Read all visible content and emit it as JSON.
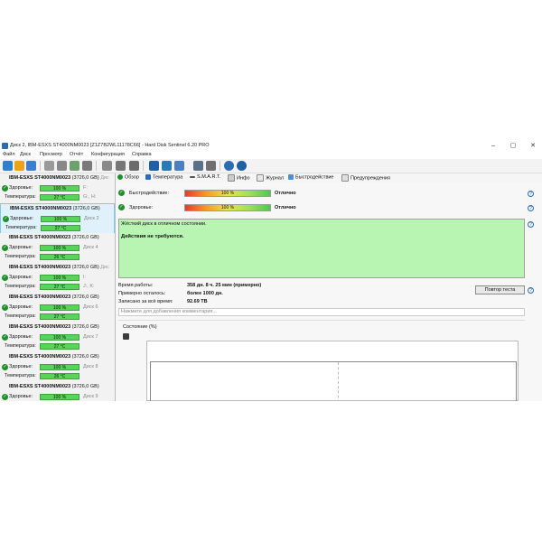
{
  "window": {
    "title": "Диск 2, IBM-ESXS ST4000NM0023 [Z1Z7B2WL11178C66] - Hard Disk Sentinel 6.20 PRO",
    "controls": [
      "–",
      "▢",
      "✕"
    ]
  },
  "menu": [
    "Файл",
    "Диск",
    "Просмотр",
    "Отчёт",
    "Конфигурация",
    "Справка"
  ],
  "disks": [
    {
      "name": "IBM-ESXS ST4000NM0023",
      "size": "(3726,0 GB)",
      "tag": "Дис",
      "health_label": "Здоровье:",
      "health": "100 %",
      "health_frac": 1.0,
      "letter": "F:",
      "temp_label": "Температура:",
      "temp": "27 °C",
      "letter2": "G:, H:",
      "selected": false
    },
    {
      "name": "IBM-ESXS ST4000NM0023",
      "size": "(3726,0 GB)",
      "tag": "",
      "health_label": "Здоровье:",
      "health": "100 %",
      "health_frac": 1.0,
      "letter": "Диск 2",
      "temp_label": "Температура:",
      "temp": "27 °C",
      "letter2": "",
      "selected": true
    },
    {
      "name": "IBM-ESXS ST4000NM0023",
      "size": "(3726,0 GB)",
      "tag": "",
      "health_label": "Здоровье:",
      "health": "100 %",
      "health_frac": 1.0,
      "letter": "Диск 4",
      "temp_label": "Температура:",
      "temp": "26 °C",
      "letter2": "",
      "selected": false
    },
    {
      "name": "IBM-ESXS ST4000NM0023",
      "size": "(3726,0 GB)",
      "tag": "Дис",
      "health_label": "Здоровье:",
      "health": "100 %",
      "health_frac": 1.0,
      "letter": "I:",
      "temp_label": "Температура:",
      "temp": "27 °C",
      "letter2": "J:, K:",
      "selected": false
    },
    {
      "name": "IBM-ESXS ST4000NM0023",
      "size": "(3726,0 GB)",
      "tag": "",
      "health_label": "Здоровье:",
      "health": "100 %",
      "health_frac": 1.0,
      "letter": "Диск 6",
      "temp_label": "Температура:",
      "temp": "27 °C",
      "letter2": "",
      "selected": false
    },
    {
      "name": "IBM-ESXS ST4000NM0023",
      "size": "(3726,0 GB)",
      "tag": "",
      "health_label": "Здоровье:",
      "health": "100 %",
      "health_frac": 1.0,
      "letter": "Диск 7",
      "temp_label": "Температура:",
      "temp": "27 °C",
      "letter2": "",
      "selected": false
    },
    {
      "name": "IBM-ESXS ST4000NM0023",
      "size": "(3726,0 GB)",
      "tag": "",
      "health_label": "Здоровье:",
      "health": "100 %",
      "health_frac": 1.0,
      "letter": "Диск 8",
      "temp_label": "Температура:",
      "temp": "26 °C",
      "letter2": "",
      "selected": false
    },
    {
      "name": "IBM-ESXS ST4000NM0023",
      "size": "(3726,0 GB)",
      "tag": "",
      "health_label": "Здоровье:",
      "health": "100 %",
      "health_frac": 1.0,
      "letter": "Диск 9",
      "temp_label": "",
      "temp": "",
      "letter2": "",
      "selected": false
    }
  ],
  "tabs": [
    {
      "label": "Обзор",
      "icon": "check-icon"
    },
    {
      "label": "Температура",
      "icon": "thermometer-icon"
    },
    {
      "label": "S.M.A.R.T.",
      "icon": "smart-icon"
    },
    {
      "label": "Инфо",
      "icon": "info-icon"
    },
    {
      "label": "Журнал",
      "icon": "log-icon"
    },
    {
      "label": "Быстродействие",
      "icon": "performance-icon"
    },
    {
      "label": "Предупреждения",
      "icon": "warning-icon"
    }
  ],
  "status": {
    "performance": {
      "label": "Быстродействие:",
      "value": "100 %",
      "fraction": 1.0,
      "text": "Отлично"
    },
    "health": {
      "label": "Здоровье:",
      "value": "100 %",
      "fraction": 1.0,
      "text": "Отлично"
    }
  },
  "message": {
    "line1": "Жёсткий диск в отличном состоянии.",
    "line2": "Действия не требуются."
  },
  "info": {
    "uptime_label": "Время работы:",
    "uptime_value": "358 дн. 8 ч. 25 мин (примерно)",
    "remaining_label": "Примерно осталось:",
    "remaining_value": "более 1000 дн.",
    "written_label": "Записано за всё время:",
    "written_value": "92.69 TB"
  },
  "test_button": "Повтор теста",
  "comment_placeholder": "Нажмите для добавления комментария...",
  "state_label": "Состояние (%)",
  "colors": {
    "ok_green": "#1e8f2a",
    "message_bg": "#b9f5b2",
    "bar_green": "#5ad35a",
    "selected_bg": "#dff2fb"
  }
}
